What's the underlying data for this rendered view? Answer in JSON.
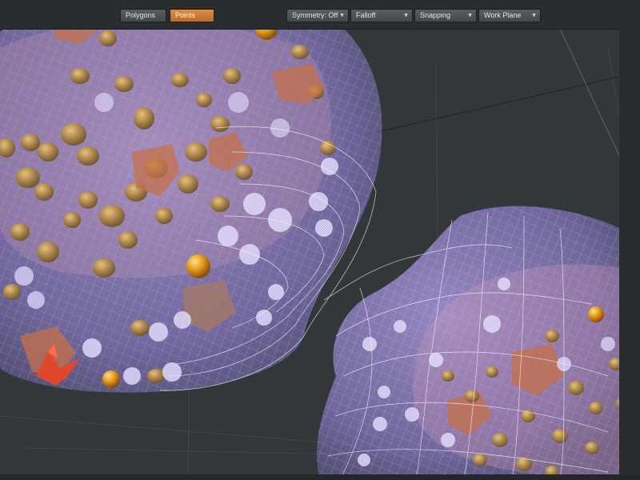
{
  "toolbar": {
    "buttons": [
      {
        "label": "Polygons",
        "active": false
      },
      {
        "label": "Points",
        "active": true
      }
    ],
    "dropdowns": [
      {
        "label": "Symmetry: Off"
      },
      {
        "label": "Falloff"
      },
      {
        "label": "Snapping"
      },
      {
        "label": "Work Plane"
      }
    ],
    "caret_glyph": "▼"
  },
  "viewport": {
    "name": "3d-perspective-viewport",
    "background": "#323739",
    "scene": "cell-membrane-meshes"
  }
}
